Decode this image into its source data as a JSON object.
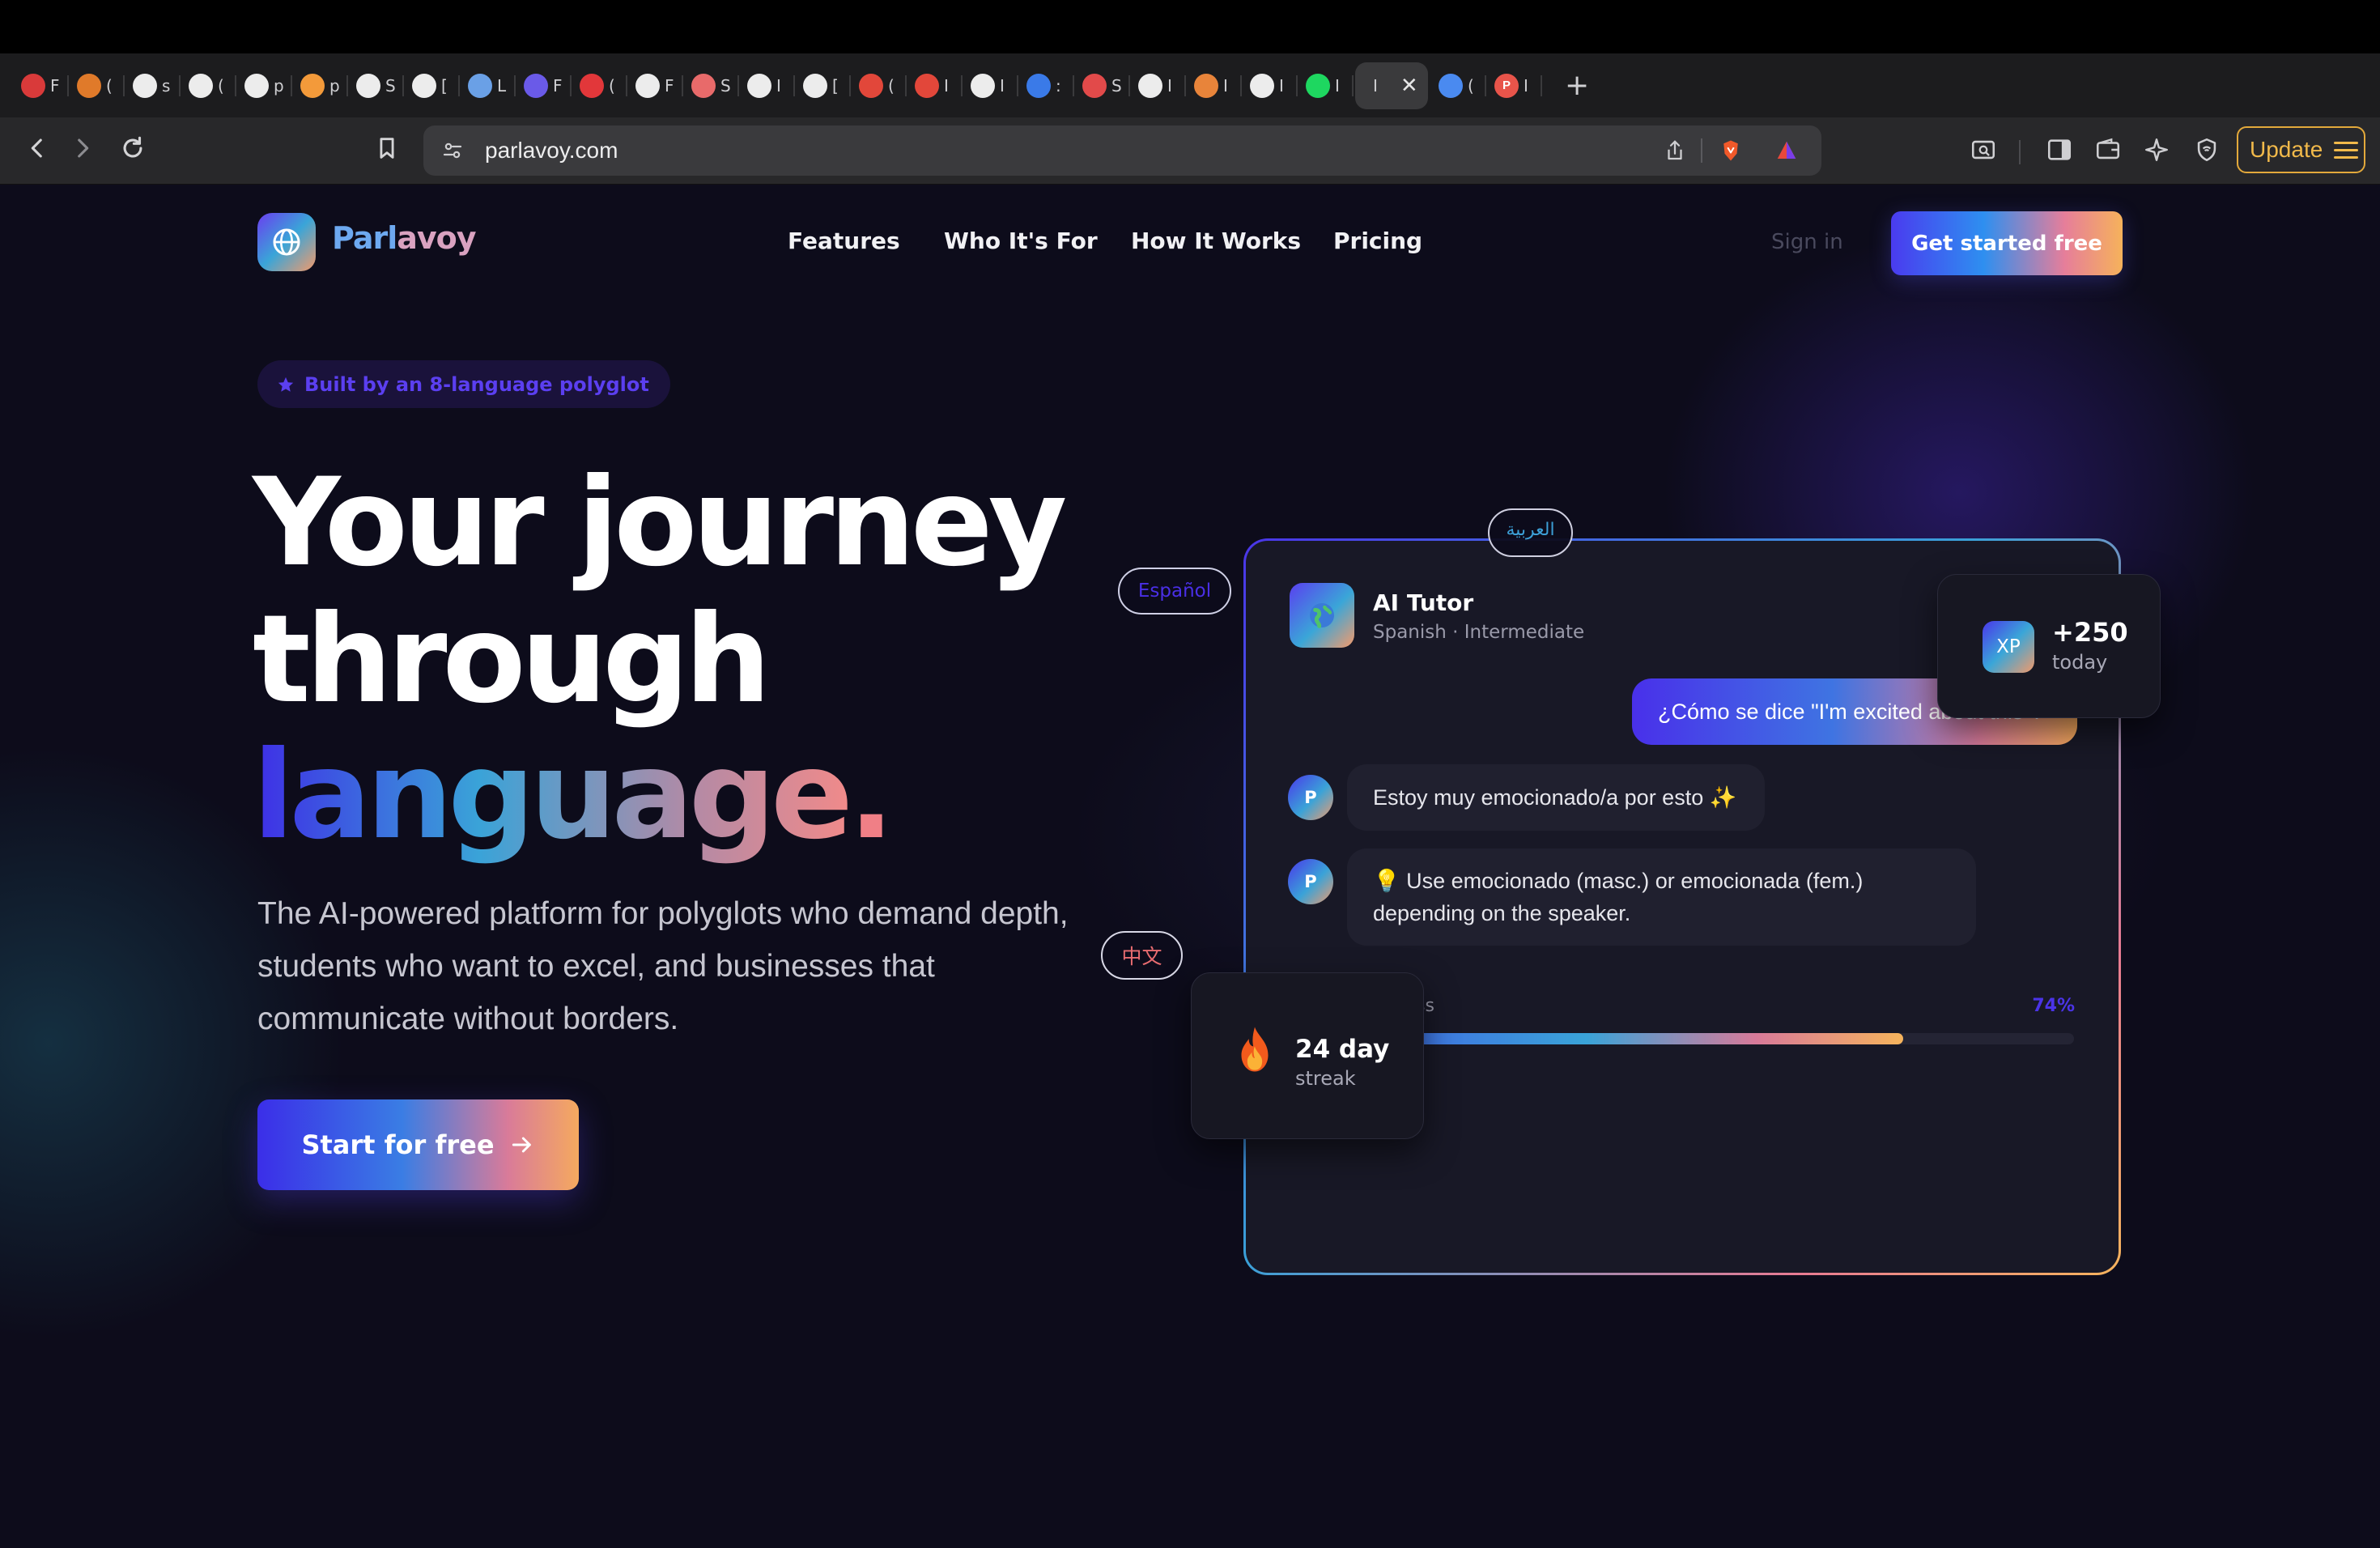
{
  "browser": {
    "tabs": [
      {
        "char": "F",
        "icon": "stacked-bars-favicon",
        "color": "#d93a3a"
      },
      {
        "char": "(",
        "icon": "hexagon-favicon",
        "color": "#e07a2a"
      },
      {
        "char": "s",
        "icon": "lines-favicon",
        "color": "#ececec"
      },
      {
        "char": "(",
        "icon": "github-favicon",
        "color": "#ececec"
      },
      {
        "char": "p",
        "icon": "triangle-favicon",
        "color": "#ececec"
      },
      {
        "char": "p",
        "icon": "cloud-favicon",
        "color": "#f39a3a"
      },
      {
        "char": "S",
        "icon": "pause-favicon",
        "color": "#ececec"
      },
      {
        "char": "[",
        "icon": "r-favicon",
        "color": "#ececec"
      },
      {
        "char": "L",
        "icon": "mosaic-favicon",
        "color": "#6aa0e6"
      },
      {
        "char": "F",
        "icon": "purple-square-favicon",
        "color": "#6a5ae8"
      },
      {
        "char": "(",
        "icon": "target-favicon",
        "color": "#e2373a"
      },
      {
        "char": "F",
        "icon": "lines-favicon",
        "color": "#ececec"
      },
      {
        "char": "S",
        "icon": "star-favicon",
        "color": "#e86a6a"
      },
      {
        "char": "I",
        "icon": "wix-favicon",
        "color": "#ececec"
      },
      {
        "char": "[",
        "icon": "u-favicon",
        "color": "#ececec"
      },
      {
        "char": "(",
        "icon": "gmail-favicon",
        "color": "#e2473a"
      },
      {
        "char": "I",
        "icon": "gmail-dark-favicon",
        "color": "#e2473a"
      },
      {
        "char": "I",
        "icon": "wix-square-favicon",
        "color": "#ececec"
      },
      {
        "char": ":",
        "icon": "z-favicon",
        "color": "#3a7ae8"
      },
      {
        "char": "S",
        "icon": "striped-circle-favicon",
        "color": "#e24a4a"
      },
      {
        "char": "I",
        "icon": "globe-favicon",
        "color": "#ececec"
      },
      {
        "char": "I",
        "icon": "sparkle-favicon",
        "color": "#e8843a"
      },
      {
        "char": "I",
        "icon": "openai-favicon",
        "color": "#ececec"
      },
      {
        "char": "I",
        "icon": "spotify-favicon",
        "color": "#1ed760"
      }
    ],
    "active_tab": {
      "char": "I"
    },
    "trailing_tabs": [
      {
        "char": "(",
        "icon": "translate-favicon",
        "color": "#4a8af0"
      },
      {
        "char": "I",
        "icon": "p-favicon",
        "color": "#e8544a",
        "letter": "P"
      }
    ],
    "close_glyph": "✕",
    "newtab_glyph": "+",
    "url": "parlavoy.com",
    "update_label": "Update"
  },
  "site": {
    "brand_a": "Parl",
    "brand_b": "avoy",
    "nav": [
      "Features",
      "Who It's For",
      "How It Works",
      "Pricing"
    ],
    "signin": "Sign in",
    "cta_top": "Get started free",
    "badge": "Built by an 8-language polyglot",
    "hero": {
      "line1": "Your journey",
      "line2": "through",
      "line3": "language",
      "dot": "."
    },
    "subtitle": "The AI-powered platform for polyglots who demand depth, students who want to excel, and businesses that communicate without borders.",
    "cta_main": "Start for free"
  },
  "demo": {
    "chips": {
      "es": "Español",
      "zh": "中文",
      "ar": "العربية"
    },
    "tutor_name": "AI Tutor",
    "tutor_sub": "Spanish · Intermediate",
    "user_msg": "¿Cómo se dice \"I'm excited about this\"?",
    "ai_avatar": "P",
    "ai_msg_1": "Estoy muy emocionado/a por esto ✨",
    "ai_msg_2": "💡 Use emocionado (masc.) or emocionada (fem.) depending on the speaker.",
    "progress_label": "ss",
    "progress_pct": "74%",
    "progress_value": 0.74,
    "xp_badge": "XP",
    "xp_value": "+250",
    "xp_sub": "today",
    "streak_value": "24 day",
    "streak_sub": "streak"
  }
}
